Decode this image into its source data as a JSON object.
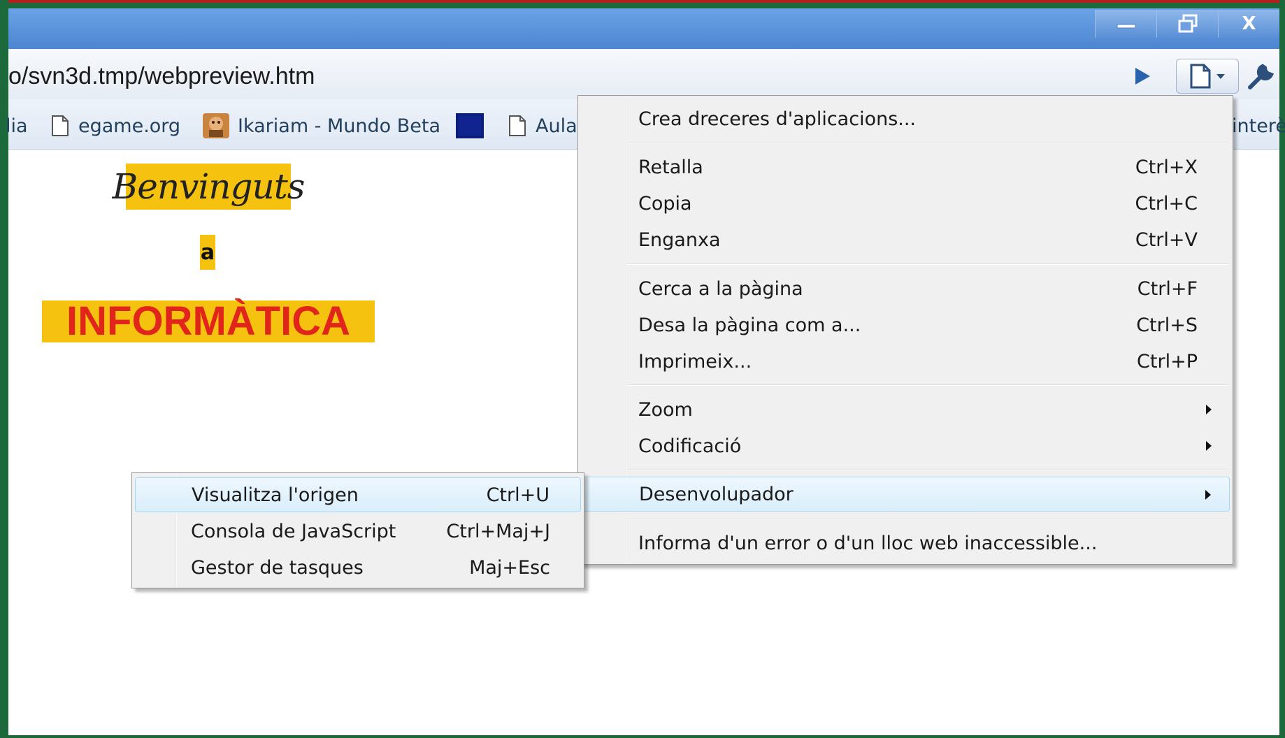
{
  "window": {
    "controls": {
      "minimize": "—",
      "restore": "❐",
      "close": "X"
    }
  },
  "toolbar": {
    "url_visible": "o/svn3d.tmp/webpreview.htm",
    "go_icon": "play-icon",
    "page_icon": "page-icon",
    "tools_icon": "wrench-icon"
  },
  "bookmarks": {
    "items": [
      {
        "label": "lia",
        "icon": "none"
      },
      {
        "label": "egame.org",
        "icon": "page-icon"
      },
      {
        "label": "Ikariam - Mundo Beta",
        "icon": "favicon-ikariam"
      },
      {
        "label": "",
        "icon": "favicon-blue-square"
      },
      {
        "label": "Aula",
        "icon": "page-icon"
      },
      {
        "label": "interè",
        "icon": "none"
      }
    ]
  },
  "page": {
    "benvinguts": "Benvinguts",
    "a": "a",
    "informatica": "INFORMÀTICA",
    "colors": {
      "highlight": "#f5c30f",
      "title_red": "#e2251b"
    }
  },
  "menu": {
    "items": [
      {
        "label": "Crea dreceres d'aplicacions...",
        "shortcut": ""
      },
      {
        "label": "Retalla",
        "shortcut": "Ctrl+X"
      },
      {
        "label": "Copia",
        "shortcut": "Ctrl+C"
      },
      {
        "label": "Enganxa",
        "shortcut": "Ctrl+V"
      },
      {
        "label": "Cerca a la pàgina",
        "shortcut": "Ctrl+F"
      },
      {
        "label": "Desa la pàgina com a...",
        "shortcut": "Ctrl+S"
      },
      {
        "label": "Imprimeix...",
        "shortcut": "Ctrl+P"
      },
      {
        "label": "Zoom",
        "shortcut": "",
        "submenu": true
      },
      {
        "label": "Codificació",
        "shortcut": "",
        "submenu": true
      },
      {
        "label": "Desenvolupador",
        "shortcut": "",
        "submenu": true,
        "highlighted": true
      },
      {
        "label": "Informa d'un error o d'un lloc web inaccessible...",
        "shortcut": ""
      }
    ]
  },
  "submenu": {
    "items": [
      {
        "label": "Visualitza l'origen",
        "shortcut": "Ctrl+U",
        "highlighted": true
      },
      {
        "label": "Consola de JavaScript",
        "shortcut": "Ctrl+Maj+J"
      },
      {
        "label": "Gestor de tasques",
        "shortcut": "Maj+Esc"
      }
    ]
  }
}
